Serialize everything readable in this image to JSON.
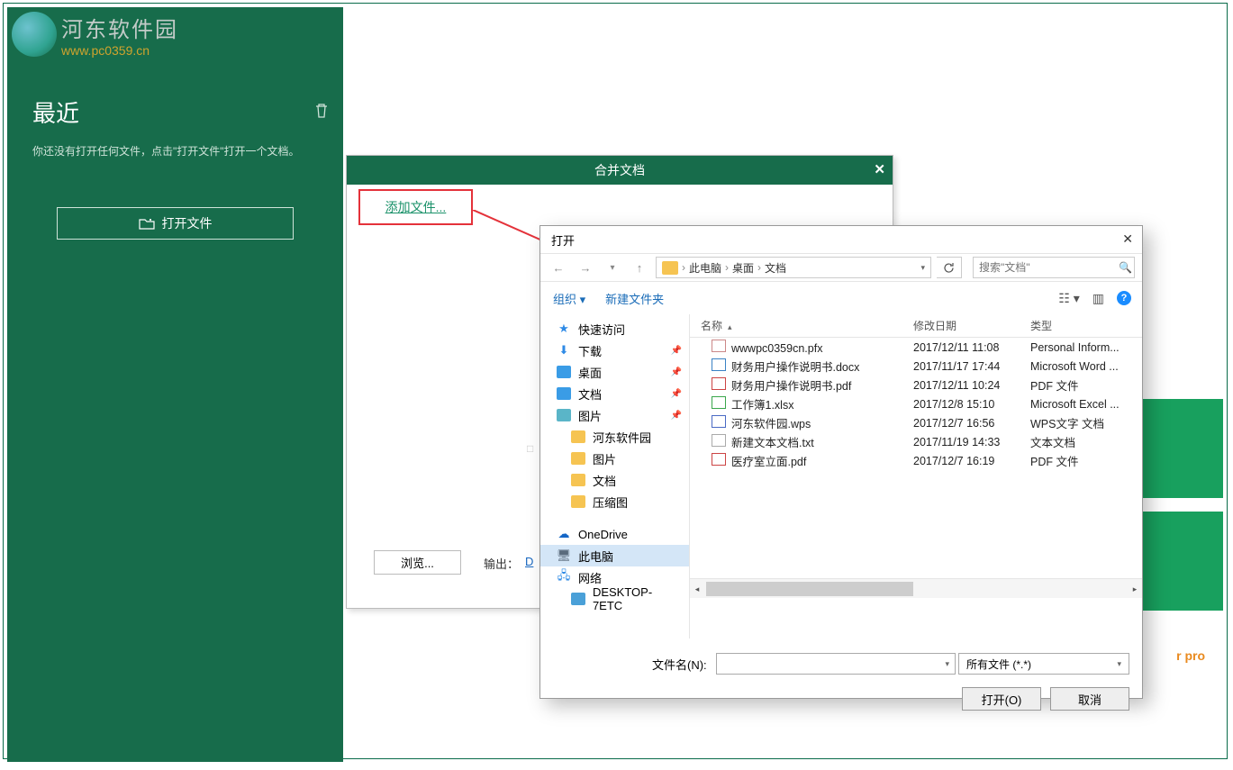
{
  "watermark": {
    "title": "河东软件园",
    "url": "www.pc0359.cn"
  },
  "sidebar": {
    "recent_title": "最近",
    "recent_hint": "你还没有打开任何文件，点击\"打开文件\"打开一个文档。",
    "open_file_label": "打开文件"
  },
  "right_pro_text": "r pro",
  "merge": {
    "title": "合并文档",
    "add_files": "添加文件...",
    "browse": "浏览...",
    "output_label": "输出：",
    "output_link": "D"
  },
  "fileDialog": {
    "title": "打开",
    "breadcrumb": [
      "此电脑",
      "桌面",
      "文档"
    ],
    "search_placeholder": "搜索\"文档\"",
    "toolbar": {
      "organize": "组织",
      "new_folder": "新建文件夹"
    },
    "columns": {
      "name": "名称",
      "date": "修改日期",
      "type": "类型"
    },
    "tree": [
      {
        "label": "快速访问",
        "ico": "star"
      },
      {
        "label": "下载",
        "ico": "dl",
        "pin": true
      },
      {
        "label": "桌面",
        "ico": "desk",
        "pin": true
      },
      {
        "label": "文档",
        "ico": "doc",
        "pin": true
      },
      {
        "label": "图片",
        "ico": "img",
        "pin": true
      },
      {
        "label": "河东软件园",
        "ico": "folder",
        "sub": true
      },
      {
        "label": "图片",
        "ico": "folder",
        "sub": true
      },
      {
        "label": "文档",
        "ico": "folder",
        "sub": true
      },
      {
        "label": "压缩图",
        "ico": "folder",
        "sub": true
      },
      {
        "label": "OneDrive",
        "ico": "cloud",
        "spaced": true
      },
      {
        "label": "此电脑",
        "ico": "pc",
        "selected": true
      },
      {
        "label": "网络",
        "ico": "net"
      },
      {
        "label": "DESKTOP-7ETC",
        "ico": "mon",
        "sub": true
      }
    ],
    "files": [
      {
        "name": "wwwpc0359cn.pfx",
        "date": "2017/12/11 11:08",
        "type": "Personal Inform...",
        "ico": "cert"
      },
      {
        "name": "财务用户操作说明书.docx",
        "date": "2017/11/17 17:44",
        "type": "Microsoft Word ...",
        "ico": "doc"
      },
      {
        "name": "财务用户操作说明书.pdf",
        "date": "2017/12/11 10:24",
        "type": "PDF 文件",
        "ico": "pdf"
      },
      {
        "name": "工作簿1.xlsx",
        "date": "2017/12/8 15:10",
        "type": "Microsoft Excel ...",
        "ico": "xls"
      },
      {
        "name": "河东软件园.wps",
        "date": "2017/12/7 16:56",
        "type": "WPS文字 文档",
        "ico": "wps"
      },
      {
        "name": "新建文本文档.txt",
        "date": "2017/11/19 14:33",
        "type": "文本文档",
        "ico": "txt"
      },
      {
        "name": "医疗室立面.pdf",
        "date": "2017/12/7 16:19",
        "type": "PDF 文件",
        "ico": "pdf"
      }
    ],
    "filename_label": "文件名(N):",
    "filter": "所有文件 (*.*)",
    "open_btn": "打开(O)",
    "cancel_btn": "取消"
  }
}
